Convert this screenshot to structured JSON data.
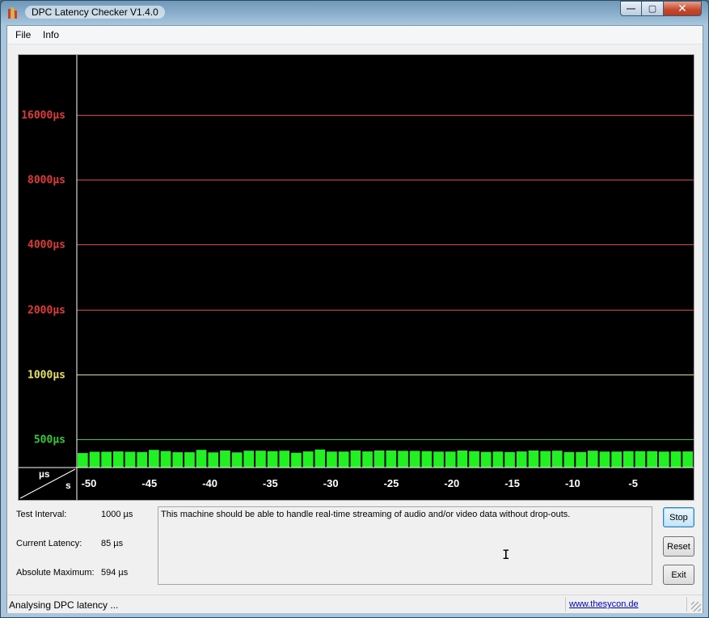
{
  "window": {
    "title": "DPC Latency Checker V1.4.0",
    "buttons": {
      "minimize": "—",
      "maximize": "▢",
      "close": "✕"
    }
  },
  "menu": {
    "items": [
      "File",
      "Info"
    ]
  },
  "chart_data": {
    "type": "bar",
    "ylabel": "µs",
    "xlabel": "s",
    "y_scale": "log",
    "y_reference_lines": [
      {
        "label": "16000µs",
        "value": 16000,
        "color": "#e03a3a"
      },
      {
        "label": "8000µs",
        "value": 8000,
        "color": "#e03a3a"
      },
      {
        "label": "4000µs",
        "value": 4000,
        "color": "#e03a3a"
      },
      {
        "label": "2000µs",
        "value": 2000,
        "color": "#e03a3a"
      },
      {
        "label": "1000µs",
        "value": 1000,
        "color": "#e8e060"
      },
      {
        "label": "500µs",
        "value": 500,
        "color": "#36c836"
      }
    ],
    "x_ticks": [
      "-50",
      "-45",
      "-40",
      "-35",
      "-30",
      "-25",
      "-20",
      "-15",
      "-10",
      "-5"
    ],
    "x_tick_values": [
      -50,
      -45,
      -40,
      -35,
      -30,
      -25,
      -20,
      -15,
      -10,
      -5
    ],
    "xlim": [
      -51,
      0
    ],
    "bar_color": "#22f022",
    "series": [
      {
        "values": [
          85,
          93,
          93,
          95,
          93,
          91,
          104,
          97,
          90,
          90,
          104,
          89,
          100,
          89,
          99,
          99,
          96,
          99,
          87,
          95,
          106,
          94,
          94,
          100,
          95,
          100,
          100,
          98,
          98,
          96,
          94,
          94,
          100,
          96,
          92,
          94,
          91,
          95,
          100,
          97,
          99,
          91,
          91,
          99,
          94,
          94,
          96,
          96,
          96,
          94,
          95,
          95
        ]
      }
    ]
  },
  "info": {
    "test_interval_label": "Test Interval:",
    "test_interval_value": "1000 µs",
    "current_latency_label": "Current Latency:",
    "current_latency_value": "85 µs",
    "absolute_maximum_label": "Absolute Maximum:",
    "absolute_maximum_value": "594 µs"
  },
  "message": "This machine should be able to handle real-time streaming of audio and/or video data without drop-outs.",
  "buttons": {
    "stop": "Stop",
    "reset": "Reset",
    "exit": "Exit"
  },
  "status": {
    "text": "Analysing DPC latency ...",
    "link": "www.thesycon.de"
  },
  "colors": {
    "chart_background": "#000000",
    "axis_label_red": "#e03a3a",
    "axis_label_yellow": "#e8e060",
    "axis_label_green": "#36c836"
  }
}
